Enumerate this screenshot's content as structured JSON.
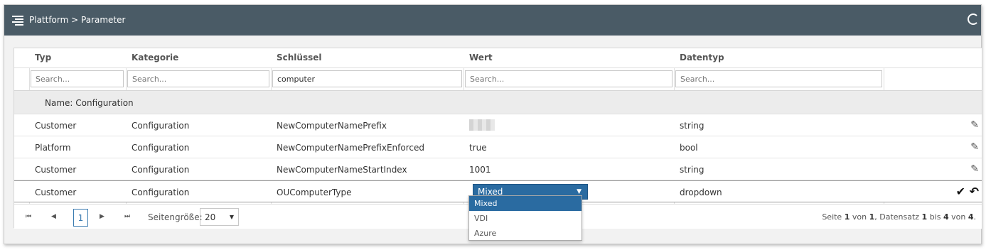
{
  "breadcrumb": "Plattform > Parameter",
  "columns": [
    "Typ",
    "Kategorie",
    "Schlüssel",
    "Wert",
    "Datentyp"
  ],
  "filters": {
    "typ": {
      "value": "",
      "placeholder": "Search..."
    },
    "kategorie": {
      "value": "",
      "placeholder": "Search..."
    },
    "schluessel": {
      "value": "computer",
      "placeholder": "Search..."
    },
    "wert": {
      "value": "",
      "placeholder": "Search..."
    },
    "datentyp": {
      "value": "",
      "placeholder": "Search..."
    }
  },
  "group_label": "Name: Configuration",
  "rows": [
    {
      "typ": "Customer",
      "kategorie": "Configuration",
      "schluessel": "NewComputerNamePrefix",
      "wert": "",
      "datentyp": "string"
    },
    {
      "typ": "Platform",
      "kategorie": "Configuration",
      "schluessel": "NewComputerNamePrefixEnforced",
      "wert": "true",
      "datentyp": "bool"
    },
    {
      "typ": "Customer",
      "kategorie": "Configuration",
      "schluessel": "NewComputerNameStartIndex",
      "wert": "1001",
      "datentyp": "string"
    },
    {
      "typ": "Customer",
      "kategorie": "Configuration",
      "schluessel": "OUComputerType",
      "wert": "Mixed",
      "datentyp": "dropdown"
    }
  ],
  "dropdown_options": [
    "Mixed",
    "VDI",
    "Azure"
  ],
  "pager": {
    "current_page": "1",
    "page_size_label": "Seitengröße:",
    "page_size": "20",
    "info": {
      "prefix": "Seite ",
      "page": "1",
      "of_pages_text": " von ",
      "pages": "1",
      "record_text": ", Datensatz ",
      "from": "1",
      "to_text": " bis ",
      "to": "4",
      "of_text": " von ",
      "total": "4",
      "suffix": "."
    }
  },
  "icons": {
    "edit": "pencil-icon",
    "save": "check-icon",
    "undo": "undo-icon",
    "menu": "menu-icon",
    "refresh": "refresh-icon"
  },
  "colors": {
    "topbar": "#4a5b66",
    "accent": "#2a6ba1"
  }
}
